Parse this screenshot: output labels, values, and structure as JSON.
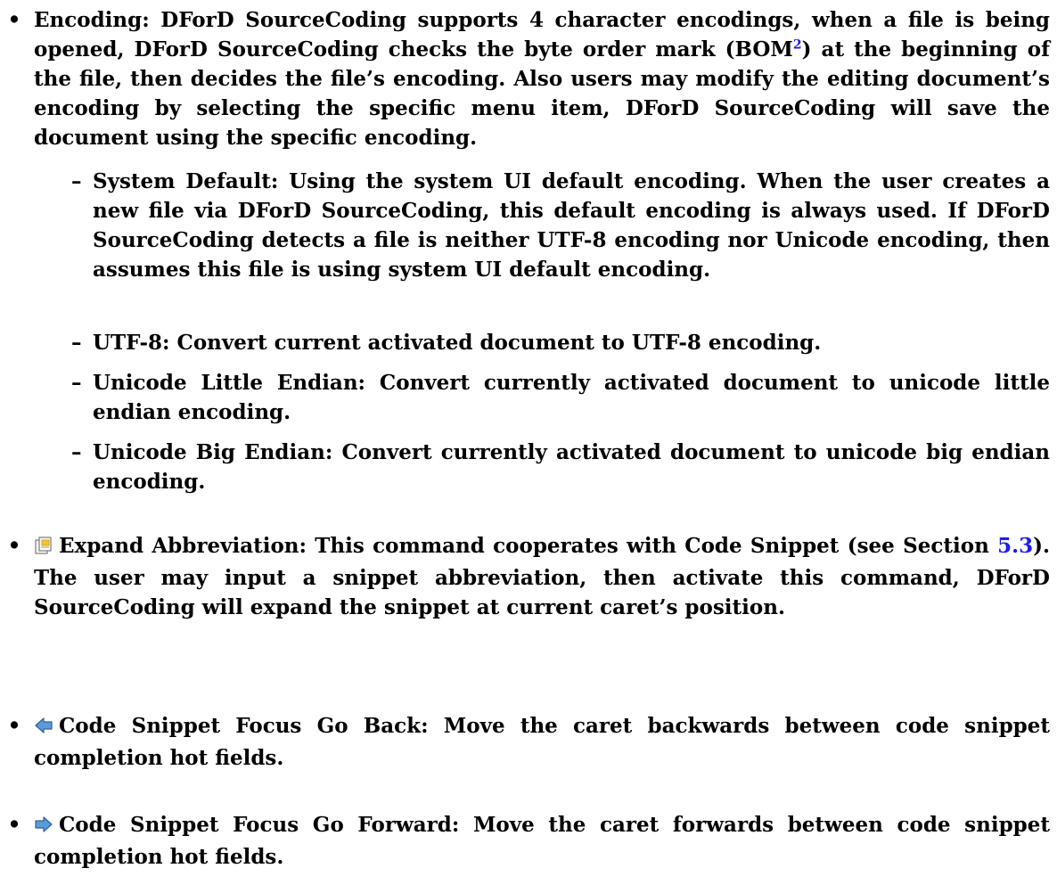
{
  "encoding": {
    "bullet": "•",
    "text_part1": "Encoding: DForD SourceCoding supports 4 character encodings, when a file is being opened, DForD SourceCoding checks the byte order mark (BOM",
    "footnote_marker": "2",
    "text_part2": ") at the beginning of the file, then decides the file’s encoding. Also users may modify the editing document’s encoding by selecting the specific menu item, DForD SourceCoding will save the document using the specific encoding.",
    "sub_items": [
      {
        "dash": "–",
        "text": "System Default: Using the system UI default encoding. When the user creates a new file via DForD SourceCoding, this default encoding is always used. If DForD SourceCoding detects a file is neither UTF-8 encoding nor Unicode encoding, then assumes this file is using system UI default encoding."
      },
      {
        "dash": "–",
        "text": "UTF-8: Convert current activated document to UTF-8 encoding."
      },
      {
        "dash": "–",
        "text": "Unicode Little Endian: Convert currently activated document to unicode little endian encoding."
      },
      {
        "dash": "–",
        "text": "Unicode Big Endian: Convert currently activated document to unicode big endian encoding."
      }
    ]
  },
  "expand": {
    "bullet": "•",
    "icon": "expand-abbreviation-icon",
    "text_part1": "Expand Abbreviation: This command cooperates with Code Snippet (see Section ",
    "section_ref": "5.3",
    "text_part2": "). The user may input a snippet abbreviation, then activate this command, DForD SourceCoding will expand the snippet at current caret’s position."
  },
  "go_back": {
    "bullet": "•",
    "icon": "arrow-left-icon",
    "text": "Code Snippet Focus Go Back: Move the caret backwards between code snippet completion hot fields."
  },
  "go_forward": {
    "bullet": "•",
    "icon": "arrow-right-icon",
    "text": "Code Snippet Focus Go Forward: Move the caret forwards between code snippet completion hot fields."
  },
  "colors": {
    "text": "#000000",
    "link": "#1a1aff",
    "arrow_icon": "#3c78d8"
  }
}
